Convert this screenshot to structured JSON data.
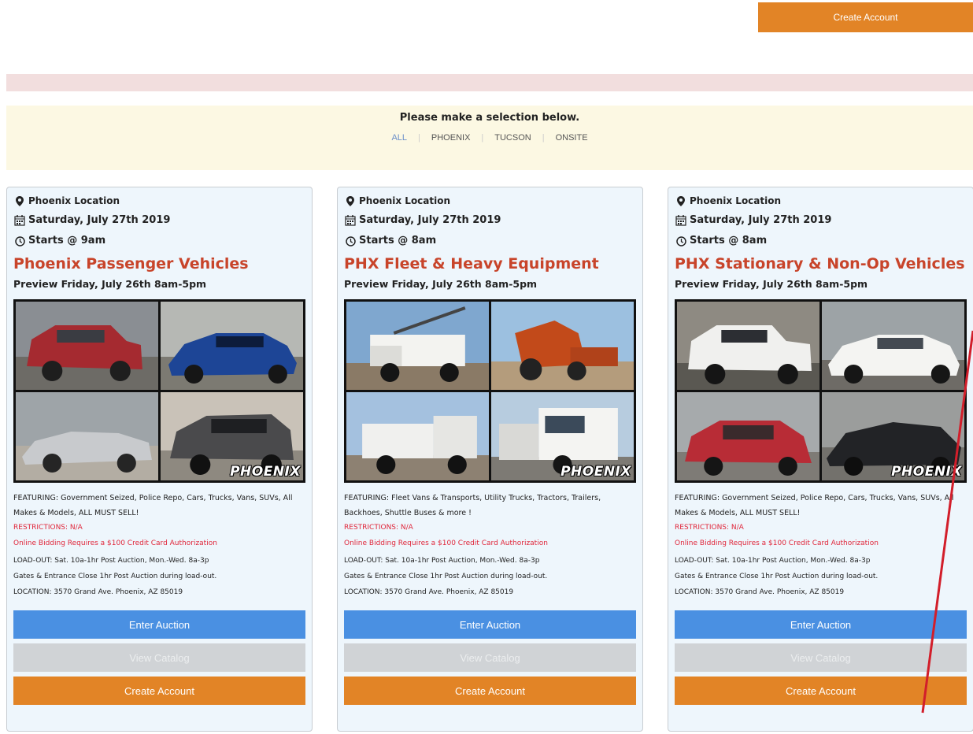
{
  "header": {
    "create_account": "Create Account"
  },
  "selection": {
    "prompt": "Please make a selection below.",
    "filters": [
      "ALL",
      "PHOENIX",
      "TUCSON",
      "ONSITE"
    ],
    "active": "ALL"
  },
  "colors": {
    "accent_orange": "#e28426",
    "button_blue": "#4a90e2",
    "title_red": "#c8442a",
    "alert_pink": "#f2dede",
    "notice_yellow": "#fcf8e3",
    "annotation_red": "#d21e2a"
  },
  "auctions": [
    {
      "location": "Phoenix Location",
      "date": "Saturday, July 27th 2019",
      "start": "Starts @ 9am",
      "title": "Phoenix Passenger Vehicles",
      "preview": "Preview Friday, July 26th 8am-5pm",
      "badge": "PHOENIX",
      "featuring": "FEATURING: Government Seized, Police Repo, Cars, Trucks, Vans, SUVs, All Makes & Models, ALL MUST SELL!",
      "restrictions": "RESTRICTIONS: N/A",
      "bidding_note": "Online Bidding Requires a $100 Credit Card Authorization",
      "load_out": "LOAD-OUT: Sat. 10a-1hr Post Auction, Mon.-Wed. 8a-3p",
      "gates": "Gates & Entrance Close 1hr Post Auction during load-out.",
      "address": "LOCATION: 3570 Grand Ave. Phoenix, AZ 85019",
      "enter": "Enter Auction",
      "catalog": "View Catalog",
      "create": "Create Account"
    },
    {
      "location": "Phoenix Location",
      "date": "Saturday, July 27th 2019",
      "start": "Starts @ 8am",
      "title": "PHX Fleet & Heavy Equipment",
      "preview": "Preview Friday, July 26th 8am-5pm",
      "badge": "PHOENIX",
      "featuring": "FEATURING: Fleet Vans & Transports, Utility Trucks, Tractors, Trailers, Backhoes, Shuttle Buses & more !",
      "restrictions": "RESTRICTIONS: N/A",
      "bidding_note": "Online Bidding Requires a $100 Credit Card Authorization",
      "load_out": "LOAD-OUT: Sat. 10a-1hr Post Auction, Mon.-Wed. 8a-3p",
      "gates": "Gates & Entrance Close 1hr Post Auction during load-out.",
      "address": "LOCATION: 3570 Grand Ave. Phoenix, AZ 85019",
      "enter": "Enter Auction",
      "catalog": "View Catalog",
      "create": "Create Account"
    },
    {
      "location": "Phoenix Location",
      "date": "Saturday, July 27th 2019",
      "start": "Starts @ 8am",
      "title": "PHX Stationary & Non-Op Vehicles",
      "preview": "Preview Friday, July 26th 8am-5pm",
      "badge": "PHOENIX",
      "featuring": "FEATURING: Government Seized, Police Repo, Cars, Trucks, Vans, SUVs, All Makes & Models, ALL MUST SELL!",
      "restrictions": "RESTRICTIONS: N/A",
      "bidding_note": "Online Bidding Requires a $100 Credit Card Authorization",
      "load_out": "LOAD-OUT: Sat. 10a-1hr Post Auction, Mon.-Wed. 8a-3p",
      "gates": "Gates & Entrance Close 1hr Post Auction during load-out.",
      "address": "LOCATION: 3570 Grand Ave. Phoenix, AZ 85019",
      "enter": "Enter Auction",
      "catalog": "View Catalog",
      "create": "Create Account"
    }
  ]
}
